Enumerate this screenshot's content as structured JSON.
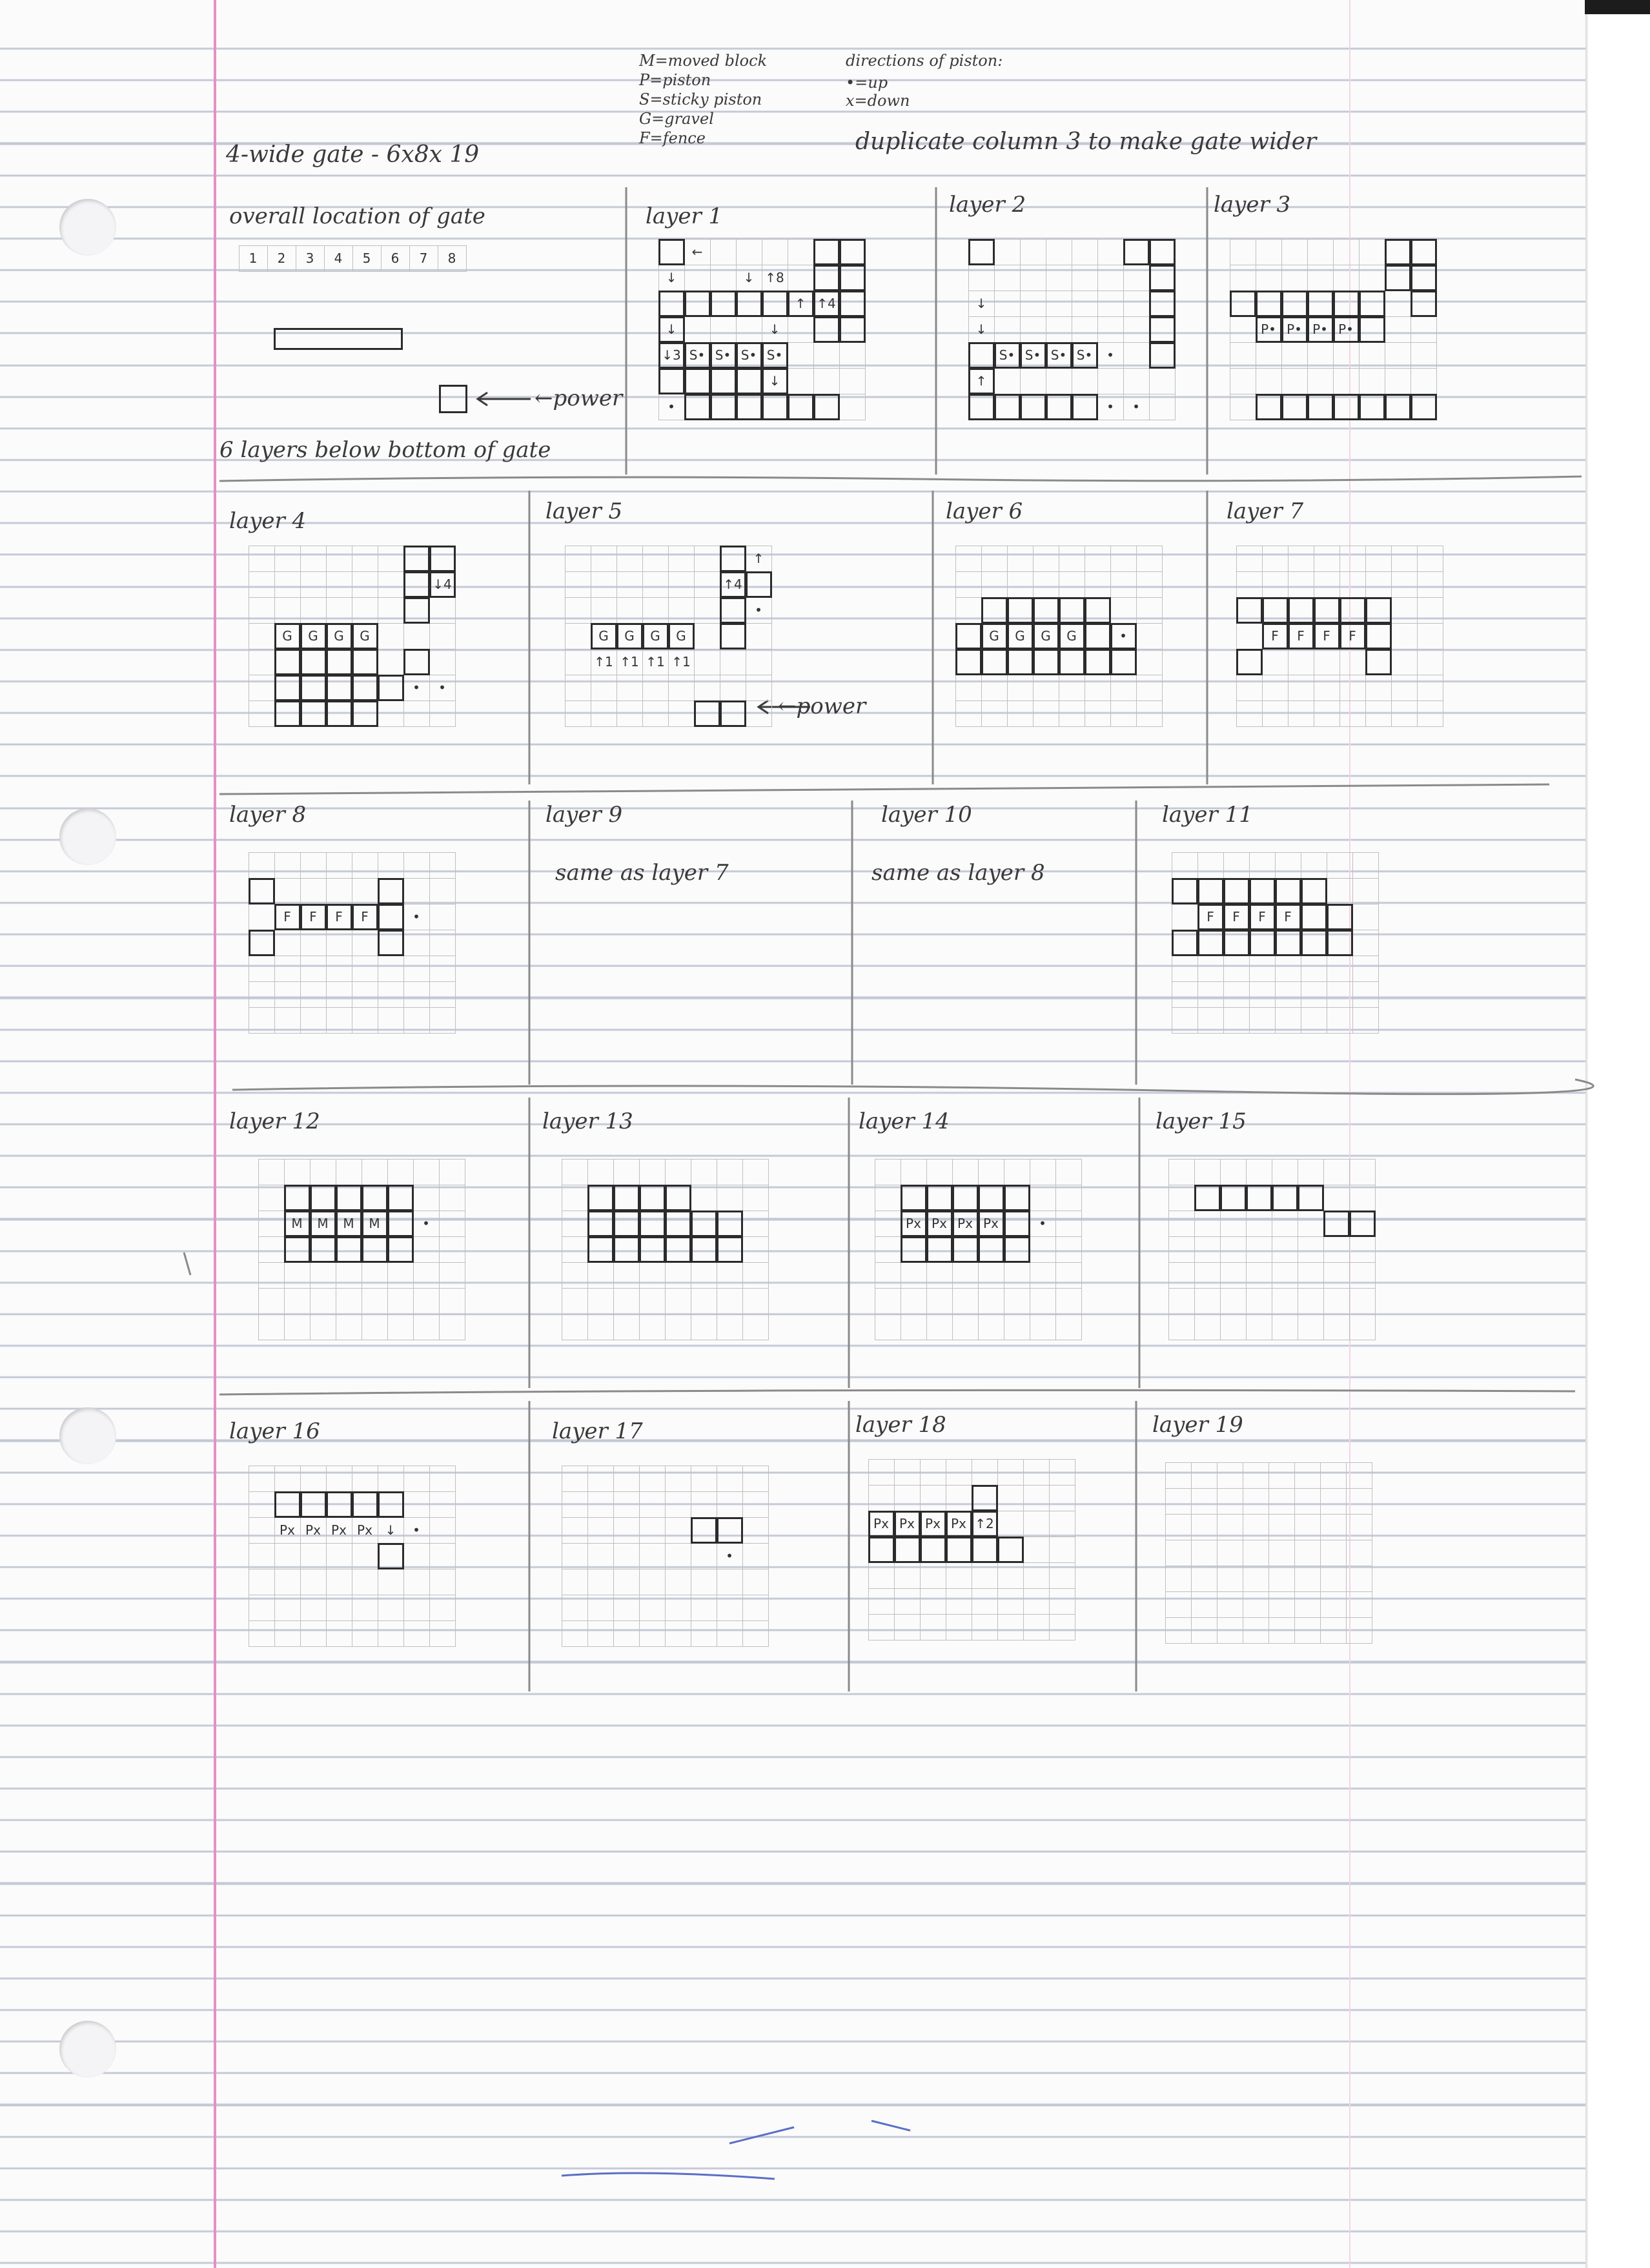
{
  "header": {
    "title": "4-wide gate - 6x8x 19",
    "legend": [
      "M=moved block",
      "P=piston",
      "S=sticky piston",
      "G=gravel",
      "F=fence"
    ],
    "directions_heading": "directions of piston:",
    "directions": [
      "•=up",
      "x=down"
    ],
    "note": "duplicate column 3 to make gate wider"
  },
  "overview": {
    "title": "overall location of gate",
    "column_numbers": [
      "1",
      "2",
      "3",
      "4",
      "5",
      "6",
      "7",
      "8"
    ],
    "power_label": "←power",
    "footer": "6 layers below bottom of gate"
  },
  "layers": [
    {
      "id": "layer-1",
      "label": "layer 1"
    },
    {
      "id": "layer-2",
      "label": "layer 2"
    },
    {
      "id": "layer-3",
      "label": "layer 3"
    },
    {
      "id": "layer-4",
      "label": "layer 4"
    },
    {
      "id": "layer-5",
      "label": "layer 5",
      "extra": "←power"
    },
    {
      "id": "layer-6",
      "label": "layer 6"
    },
    {
      "id": "layer-7",
      "label": "layer 7"
    },
    {
      "id": "layer-8",
      "label": "layer 8"
    },
    {
      "id": "layer-9",
      "label": "layer 9",
      "note": "same as layer 7"
    },
    {
      "id": "layer-10",
      "label": "layer 10",
      "note": "same as layer 8"
    },
    {
      "id": "layer-11",
      "label": "layer 11"
    },
    {
      "id": "layer-12",
      "label": "layer 12"
    },
    {
      "id": "layer-13",
      "label": "layer 13"
    },
    {
      "id": "layer-14",
      "label": "layer 14"
    },
    {
      "id": "layer-15",
      "label": "layer 15"
    },
    {
      "id": "layer-16",
      "label": "layer 16"
    },
    {
      "id": "layer-17",
      "label": "layer 17"
    },
    {
      "id": "layer-18",
      "label": "layer 18"
    },
    {
      "id": "layer-19",
      "label": "layer 19"
    }
  ],
  "cell_text": {
    "layer-1": [
      "←",
      "↓",
      "↓",
      "↑8",
      "↓",
      "↓",
      "↑",
      "↑4",
      "↓3",
      "S•",
      "S•",
      "S•",
      "S•",
      "↓",
      "•"
    ],
    "layer-2": [
      "↓",
      "↓",
      "S•",
      "S•",
      "S•",
      "S•",
      "•",
      "↑",
      "•",
      "•"
    ],
    "layer-3": [
      "P•",
      "P•",
      "P•",
      "P•"
    ],
    "layer-4": [
      "↓4",
      "G",
      "G",
      "G",
      "G",
      "•",
      "•"
    ],
    "layer-5": [
      "↑",
      "↑4",
      "•",
      "G",
      "G",
      "G",
      "G",
      "↑1",
      "↑1",
      "↑1",
      "↑1"
    ],
    "layer-6": [
      "G",
      "G",
      "G",
      "G",
      "•"
    ],
    "layer-7": [
      "F",
      "F",
      "F",
      "F"
    ],
    "layer-8": [
      "F",
      "F",
      "F",
      "F",
      "•"
    ],
    "layer-11": [
      "F",
      "F",
      "F",
      "F"
    ],
    "layer-12": [
      "M",
      "M",
      "M",
      "M",
      "•"
    ],
    "layer-14": [
      "Px",
      "Px",
      "Px",
      "Px",
      "•"
    ],
    "layer-16": [
      "Px",
      "Px",
      "Px",
      "Px",
      "↓",
      "•"
    ],
    "layer-17": [
      "•"
    ],
    "layer-18": [
      "Px",
      "Px",
      "Px",
      "Px",
      "↑2"
    ]
  },
  "colors": {
    "paper": "#fbfbfc",
    "rule_line": "#c3c8d6",
    "margin_line": "#e78fc4",
    "pencil": "#3a3a3a",
    "ink_blue": "#5a6fc6"
  }
}
